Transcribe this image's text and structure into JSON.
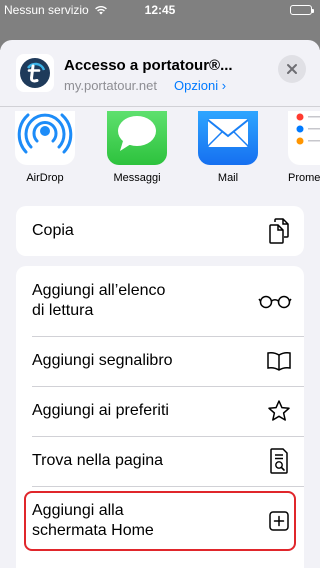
{
  "status_bar": {
    "carrier": "Nessun servizio",
    "time": "12:45"
  },
  "share_header": {
    "title": "Accesso a portatour®...",
    "url": "my.portatour.net",
    "options_label": "Opzioni",
    "options_chevron": "›"
  },
  "apps": [
    {
      "label": "AirDrop",
      "icon": "airdrop-icon"
    },
    {
      "label": "Messaggi",
      "icon": "messages-icon"
    },
    {
      "label": "Mail",
      "icon": "mail-icon"
    },
    {
      "label": "Prome",
      "icon": "reminders-icon"
    }
  ],
  "actions_group_1": [
    {
      "label": "Copia",
      "icon": "copy-icon"
    }
  ],
  "actions_group_2": [
    {
      "label": "Aggiungi all’elenco\ndi lettura",
      "icon": "glasses-icon"
    },
    {
      "label": "Aggiungi segnalibro",
      "icon": "book-icon"
    },
    {
      "label": "Aggiungi ai preferiti",
      "icon": "star-icon"
    },
    {
      "label": "Trova nella pagina",
      "icon": "find-in-page-icon"
    },
    {
      "label": "Aggiungi alla\nschermata Home",
      "icon": "add-square-icon"
    }
  ],
  "colors": {
    "accent": "#007aff",
    "highlight": "#e0262b",
    "messages_green": "#2dc23d",
    "mail_blue": "#1670f0"
  }
}
